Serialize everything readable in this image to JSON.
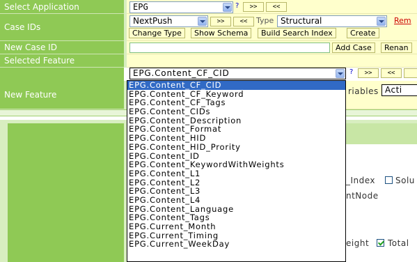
{
  "labels": {
    "select_application": "Select Application",
    "case_ids": "Case IDs",
    "new_case_id": "New Case ID",
    "selected_feature": "Selected Feature",
    "new_feature": "New Feature"
  },
  "application": {
    "value": "EPG",
    "help": "?",
    "next": ">>",
    "prev": "<<"
  },
  "case_ids": {
    "value": "NextPush",
    "next": ">>",
    "prev": "<<",
    "type_label": "Type",
    "type_value": "Structural",
    "remove_partial": "Rem",
    "change_type": "Change Type",
    "show_schema": "Show Schema",
    "build_search_index": "Build Search Index",
    "create_partial": "Create"
  },
  "new_case": {
    "input_value": "",
    "add_case": "Add Case",
    "rename_partial": "Renan"
  },
  "feature": {
    "value": "EPG.Content_CF_CID",
    "help": "?",
    "next": ">>",
    "prev": "<<",
    "options": [
      "EPG.Content_CF_CID",
      "EPG.Content_CF_Keyword",
      "EPG.Content_CF_Tags",
      "EPG.Content_CIDs",
      "EPG.Content_Description",
      "EPG.Content_Format",
      "EPG.Content_HID",
      "EPG.Content_HID_Prority",
      "EPG.Content_ID",
      "EPG.Content_KeywordWithWeights",
      "EPG.Content_L1",
      "EPG.Content_L2",
      "EPG.Content_L3",
      "EPG.Content_L4",
      "EPG.Content_Language",
      "EPG.Content_Tags",
      "EPG.Current_Month",
      "EPG.Current_Timing",
      "EPG.Current_WeekDay"
    ],
    "selected_index": 0
  },
  "new_feature": {
    "variables_partial": "riables",
    "action_partial": "Acti"
  },
  "behind": {
    "index_partial": "_Index",
    "solu_partial": "Solu",
    "node_partial": "ntNode",
    "weight_partial": "eight",
    "total_partial": "Total"
  }
}
